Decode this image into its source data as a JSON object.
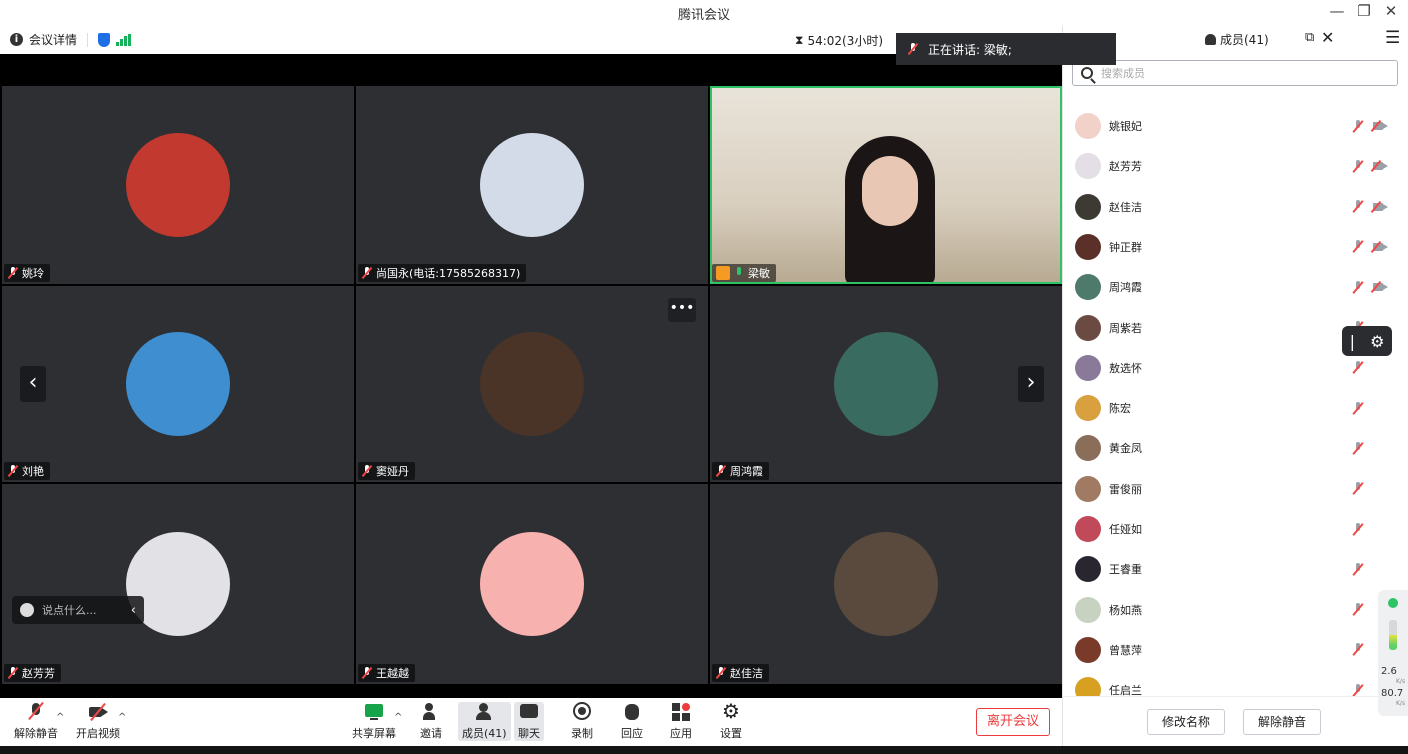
{
  "window": {
    "title": "腾讯会议",
    "min": "—",
    "restore": "❐",
    "close": "✕"
  },
  "infobar": {
    "details_label": "会议详情",
    "info_glyph": "i",
    "timer": "54:02(3小时)",
    "timer_glyph": "⧗"
  },
  "speaking": {
    "label": "正在讲话:",
    "name": "梁敏;"
  },
  "tiles": [
    {
      "name": "姚玲",
      "avatar_color": "#c2392f",
      "active": false,
      "mic": "off"
    },
    {
      "name": "尚国永(电话:17585268317)",
      "avatar_color": "#d4dbe8",
      "active": false,
      "mic": "off"
    },
    {
      "name": "梁敏",
      "avatar_color": "#d8cdbb",
      "active": true,
      "mic": "on"
    },
    {
      "name": "刘艳",
      "avatar_color": "#3f8fd0",
      "active": false,
      "mic": "off"
    },
    {
      "name": "窦娅丹",
      "avatar_color": "#4a3428",
      "active": false,
      "mic": "off"
    },
    {
      "name": "周鸿霞",
      "avatar_color": "#3a6b60",
      "active": false,
      "mic": "off"
    },
    {
      "name": "赵芳芳",
      "avatar_color": "#e2e2e6",
      "active": false,
      "mic": "off"
    },
    {
      "name": "王越越",
      "avatar_color": "#f7b2b0",
      "active": false,
      "mic": "off"
    },
    {
      "name": "赵佳洁",
      "avatar_color": "#5a4a3e",
      "active": false,
      "mic": "off"
    }
  ],
  "more_glyph": "•••",
  "nav": {
    "prev": "‹",
    "next": "›"
  },
  "chat": {
    "placeholder": "说点什么...",
    "collapse": "‹"
  },
  "panel": {
    "title": "成员(41)",
    "pop_glyph": "⧉",
    "close_glyph": "✕",
    "menu_glyph": "☰",
    "search_placeholder": "搜索成员",
    "members": [
      {
        "name": "姚银妃",
        "color": "#f2d2c8",
        "cam": true
      },
      {
        "name": "赵芳芳",
        "color": "#e4dfe6",
        "cam": true
      },
      {
        "name": "赵佳洁",
        "color": "#3d3a34",
        "cam": true
      },
      {
        "name": "钟正群",
        "color": "#5a3028",
        "cam": true
      },
      {
        "name": "周鸿霞",
        "color": "#4d7a6a",
        "cam": true
      },
      {
        "name": "周紫若",
        "color": "#6b4a42",
        "cam": false
      },
      {
        "name": "敖选怀",
        "color": "#8a7a9a",
        "cam": false
      },
      {
        "name": "陈宏",
        "color": "#d9a040",
        "cam": false
      },
      {
        "name": "黄金凤",
        "color": "#8a6e5a",
        "cam": false
      },
      {
        "name": "雷俊丽",
        "color": "#a07a62",
        "cam": false
      },
      {
        "name": "任娅如",
        "color": "#c04a5a",
        "cam": false
      },
      {
        "name": "王睿重",
        "color": "#2a2630",
        "cam": false
      },
      {
        "name": "杨如燕",
        "color": "#c8d2c0",
        "cam": false
      },
      {
        "name": "曾慧萍",
        "color": "#7a3a2a",
        "cam": false
      },
      {
        "name": "任启兰",
        "color": "#d8a020",
        "cam": false
      }
    ],
    "rename_button": "修改名称",
    "unmute_button": "解除静音"
  },
  "gear_glyph": "⚙",
  "gear_handle": "|",
  "network": {
    "down": "2.6",
    "up": "80.7",
    "unit": "K/s"
  },
  "toolbar": {
    "unmute": "解除静音",
    "start_video": "开启视频",
    "share": "共享屏幕",
    "invite": "邀请",
    "members": "成员(41)",
    "chat": "聊天",
    "record": "录制",
    "react": "回应",
    "apps": "应用",
    "settings": "设置",
    "leave": "离开会议",
    "caret": "^"
  },
  "colors": {
    "accent_green": "#2ec466",
    "leave_red": "#ee3b3b",
    "tile_bg": "#2d2f33"
  }
}
